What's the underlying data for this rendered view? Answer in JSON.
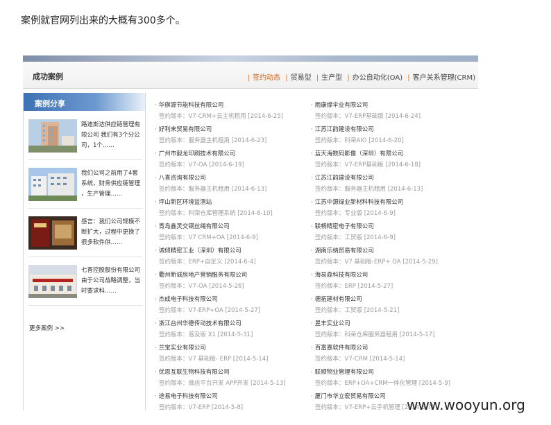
{
  "intro_text": "案例就官网列出来的大概有300多个。",
  "header": {
    "title": "成功案例",
    "nav": [
      "签约动态",
      "贸易型",
      "生产型",
      "办公自动化(OA)",
      "客户关系管理(CRM)"
    ]
  },
  "sidebar": {
    "title": "案例分享",
    "cases": [
      {
        "lines": [
          "路迪斯达供应链管理有",
          "限公司 我们有3个分公",
          "司，1个……"
        ]
      },
      {
        "lines": [
          "我们公司之前用了4套",
          "系统，财务供应链管理",
          "，生产管理……"
        ]
      },
      {
        "lines": [
          "感言：我们公司规模不",
          "断扩大，过程中更换了",
          "很多软件供……"
        ]
      },
      {
        "lines": [
          "七喜控股股份有限公司",
          "由于公司战略调整，当",
          "时要求科……"
        ]
      }
    ],
    "more_label": "更多案例 >>"
  },
  "companies_left": [
    {
      "name": "华旗源节能科技有限公司",
      "meta": "签约版本：V7-CRM+云主机租用 [2014-6-25]"
    },
    {
      "name": "好利来贸易有限公司",
      "meta": "签约版本：服务器主机租用 [2014-6-23]"
    },
    {
      "name": "广州市毅龙印刷技术有限公司",
      "meta": "签约版本：V7-OA [2014-6-19]"
    },
    {
      "name": "八喜咨询有限公司",
      "meta": "签约版本：服务器主机租用 [2014-6-13]"
    },
    {
      "name": "坪山新区环境监测站",
      "meta": "签约版本：科荣仓库管理系统 [2014-6-10]"
    },
    {
      "name": "青岛鑫灵交钢丝绳有限公司",
      "meta": "签约版本：V7 CRM+OA [2014-6-9]"
    },
    {
      "name": "诚倾精密工业（深圳）有限公司",
      "meta": "签约版本：ERP+自定义 [2014-6-4]"
    },
    {
      "name": "衢州新诚房地产营销服务有限公司",
      "meta": "签约版本：V7-OA [2014-5-26]"
    },
    {
      "name": "杰成电子科技有限公司",
      "meta": "签约版本：V7-ERP+OA [2014-5-27]"
    },
    {
      "name": "浙江台州华德传动技术有限公司",
      "meta": "签约版本：普及版 X1 [2014-5-31]"
    },
    {
      "name": "兰宝实业有限公司",
      "meta": "签约版本：V7 基础版- ERP [2014-5-14]"
    },
    {
      "name": "优恩互联生物科技有限公司",
      "meta": "签约版本：微店平台开发 APP开发 [2014-5-13]"
    },
    {
      "name": "途易电子科技有限公司",
      "meta": "签约版本：V7-ERP [2014-5-8]"
    }
  ],
  "companies_right": [
    {
      "name": "雨康缘伞业有限公司",
      "meta": "签约版本：V7-ERP基础版 [2014-6-24]"
    },
    {
      "name": "江苏江韵建设有限公司",
      "meta": "签约版本：科荣AIO [2014-6-20]"
    },
    {
      "name": "蓝天海数码影像（深圳）有限公司",
      "meta": "签约版本：V7-ERP基础版 [2014-6-18]"
    },
    {
      "name": "江苏江韵建设有限公司",
      "meta": "签约版本：服务器主机租用 [2014-6-13]"
    },
    {
      "name": "江苏中源绿业新材料科技有限公司",
      "meta": "签约版本：专业版 [2014-6-9]"
    },
    {
      "name": "联畅精密电子有限公司",
      "meta": "签约版本：工贸版 [2014-6-9]"
    },
    {
      "name": "湖南乐纳贸易有限公司",
      "meta": "签约版本：V7 基础版-ERP+ OA [2014-5-29]"
    },
    {
      "name": "海易森科技有限公司",
      "meta": "签约版本：ERP [2014-5-27]"
    },
    {
      "name": "德拓建材有限公司",
      "meta": "签约版本：工贸版 [2014-5-21]"
    },
    {
      "name": "昱丰实业公司",
      "meta": "签约版本：科荣仓库服务器租用 [2014-5-17]"
    },
    {
      "name": "百富嘉软件有限公司",
      "meta": "签约版本：V7-CRM [2014-5-14]"
    },
    {
      "name": "联顺物业管理有限公司",
      "meta": "签约版本：ERP+OA+CRM一体化管理 [2014-5-9]"
    },
    {
      "name": "厦门市华立宏贸易有限公司",
      "meta": "签约版本：V7-ERP+云手机管理 [2014-5-7]"
    }
  ],
  "watermark": "www.wooyun.org"
}
